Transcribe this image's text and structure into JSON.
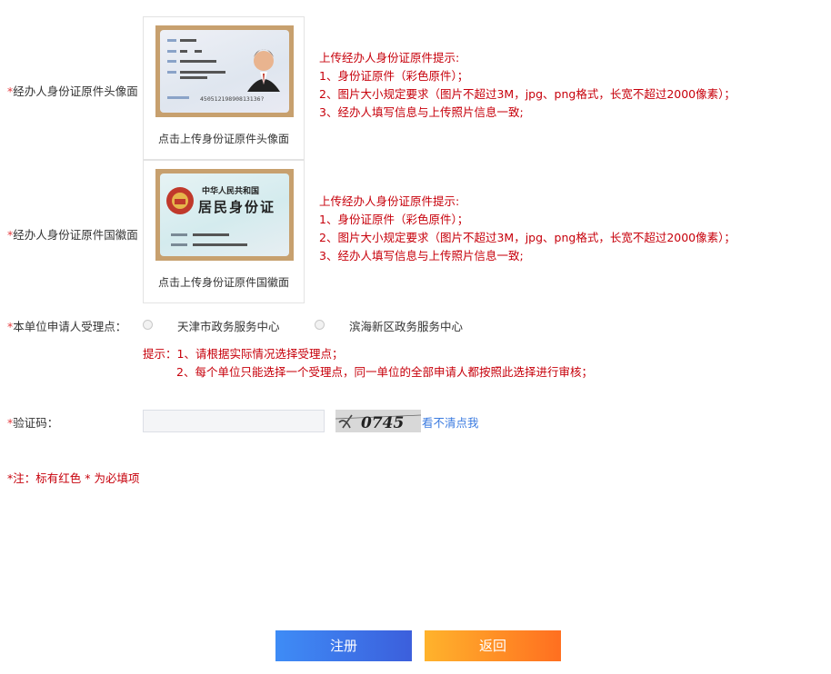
{
  "required_mark": "*",
  "front": {
    "label": "经办人身份证原件头像面",
    "caption": "点击上传身份证原件头像面",
    "card_number_text": "45051219890813136?"
  },
  "back": {
    "label": "经办人身份证原件国徽面",
    "caption": "点击上传身份证原件国徽面",
    "card_title_1": "中华人民共和国",
    "card_title_2": "居民身份证"
  },
  "tips": {
    "title": "上传经办人身份证原件提示:",
    "line1": "1、身份证原件（彩色原件）；",
    "line2": "2、图片大小规定要求（图片不超过3M，jpg、png格式，长宽不超过2000像素）；",
    "line3": "3、经办人填写信息与上传照片信息一致;"
  },
  "site": {
    "label": "本单位申请人受理点：",
    "options": [
      "天津市政务服务中心",
      "滨海新区政务服务中心"
    ],
    "hint_line1": "提示：1、请根据实际情况选择受理点；",
    "hint_line2": "2、每个单位只能选择一个受理点，同一单位的全部申请人都按照此选择进行审核；"
  },
  "captcha": {
    "label": "验证码：",
    "value": "",
    "image_text": "0745",
    "refresh_label": "看不清点我"
  },
  "note": {
    "prefix": "*注：标有红色",
    "star": "*",
    "suffix": "为必填项"
  },
  "buttons": {
    "register": "注册",
    "back": "返回"
  },
  "colors": {
    "required": "#e4393c",
    "tip_text": "#c7000b",
    "link": "#3b7be0",
    "register_btn": "#3e8cf6",
    "back_btn": "#ff8f20"
  }
}
